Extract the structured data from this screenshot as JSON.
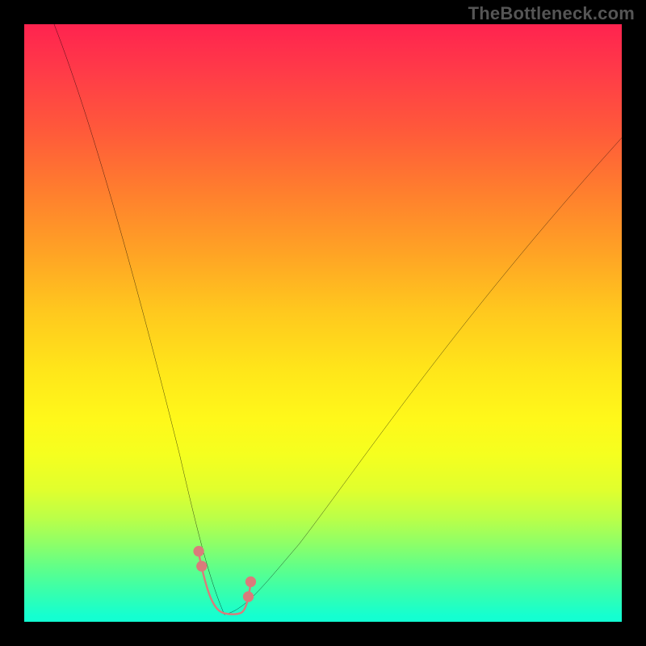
{
  "watermark": {
    "text": "TheBottleneck.com"
  },
  "chart_data": {
    "type": "line",
    "title": "",
    "xlabel": "",
    "ylabel": "",
    "xlim": [
      0,
      100
    ],
    "ylim": [
      0,
      100
    ],
    "grid": false,
    "legend": null,
    "series": [
      {
        "name": "bottleneck-curve",
        "color": "#000000",
        "x": [
          5,
          8,
          12,
          16,
          20,
          24,
          26,
          28,
          30,
          31,
          32,
          33,
          34,
          35,
          36,
          37,
          38,
          40,
          44,
          50,
          58,
          68,
          80,
          92,
          100
        ],
        "y": [
          100,
          86,
          70,
          55,
          41,
          28,
          22,
          16,
          10,
          7,
          5,
          2,
          1,
          1,
          1,
          2,
          3,
          5,
          10,
          18,
          30,
          44,
          60,
          74,
          82
        ]
      },
      {
        "name": "optimal-marker",
        "color": "#e17a7a",
        "style": "thick-rounded",
        "x": [
          29.5,
          30,
          30.5,
          31,
          31.5,
          32,
          33,
          34,
          35,
          36,
          36.5,
          37,
          37.5
        ],
        "y": [
          11,
          8.5,
          6,
          4.5,
          3,
          2.2,
          1.5,
          1.4,
          1.4,
          1.6,
          2.4,
          4,
          6
        ]
      }
    ],
    "notes": "Values are approximate, inferred from pixel positions against a 0–100 normalized axis in both directions. The chart has no visible axis ticks, labels, title, or legend; background is a vertical red→yellow→green gradient indicating bottleneck severity. The black curve is a V-shaped bottleneck curve with its minimum near x≈34. The coral-colored thick rounded overlay near the trough highlights the optimal (near-zero bottleneck) region."
  }
}
